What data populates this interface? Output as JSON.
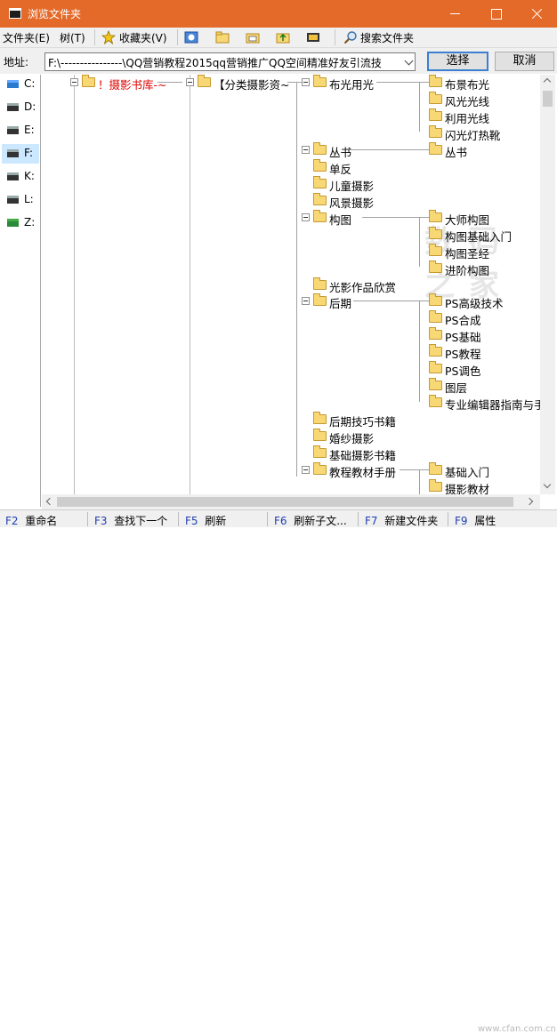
{
  "window": {
    "title": "浏览文件夹"
  },
  "menu": {
    "items": [
      "文件夹(E)",
      "树(T)",
      "收藏夹(V)",
      "搜索文件夹"
    ]
  },
  "address": {
    "label": "地址:",
    "value": "F:\\----------------\\QQ营销教程2015qq营销推广QQ空间精准好友引流技",
    "select_label": "选择",
    "cancel_label": "取消"
  },
  "drives": [
    "C:",
    "D:",
    "E:",
    "F:",
    "K:",
    "L:",
    "Z:"
  ],
  "selected_drive": "F:",
  "tree": {
    "root": "！摄影书库-~",
    "level1": "【分类摄影资~",
    "items": [
      "布光用光",
      "布景布光",
      "风光光线",
      "利用光线",
      "闪光灯热靴",
      "丛书",
      "丛书",
      "单反",
      "儿童摄影",
      "风景摄影",
      "构图",
      "大师构图",
      "构图基础入门",
      "构图圣经",
      "进阶构图",
      "光影作品欣赏",
      "后期",
      "PS高级技术",
      "PS合成",
      "PS基础",
      "PS教程",
      "PS调色",
      "图层",
      "专业编辑器指南与手",
      "后期技巧书籍",
      "婚纱摄影",
      "基础摄影书籍",
      "教程教材手册",
      "基础入门",
      "摄影教材"
    ]
  },
  "watermark": "数 码 之 家",
  "status": {
    "items": [
      {
        "key": "F2",
        "label": "重命名"
      },
      {
        "key": "F3",
        "label": "查找下一个"
      },
      {
        "key": "F5",
        "label": "刷新"
      },
      {
        "key": "F6",
        "label": "刷新子文..."
      },
      {
        "key": "F7",
        "label": "新建文件夹"
      },
      {
        "key": "F9",
        "label": "属性"
      }
    ],
    "corner": "www.cfan.com.cn"
  }
}
